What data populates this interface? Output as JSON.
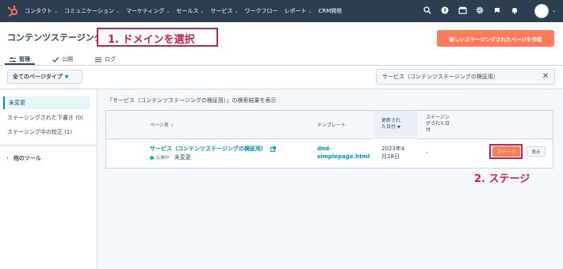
{
  "nav": {
    "items": [
      "コンタクト",
      "コミュニケーション",
      "マーケティング",
      "セールス",
      "サービス",
      "ワークフロー",
      "レポート",
      "CRM開発"
    ],
    "has_chevron": [
      true,
      true,
      true,
      true,
      true,
      false,
      true,
      false
    ],
    "icons": [
      "search-icon",
      "help-icon",
      "marketplace-icon",
      "settings-icon",
      "notifications-icon",
      "bell-icon"
    ]
  },
  "page": {
    "title": "コンテンツステージング",
    "annotation1": "1. ドメインを選択",
    "create_button": "新しいステージングされたページを作成"
  },
  "tabs": [
    {
      "label": "管理",
      "icon": "sliders-icon",
      "active": true
    },
    {
      "label": "公開",
      "icon": "check-icon",
      "active": false
    },
    {
      "label": "ログ",
      "icon": "list-icon",
      "active": false
    }
  ],
  "filter": {
    "page_type": "全てのページタイプ",
    "search_value": "サービス（コンテンツステージングの検証用）"
  },
  "sidebar": {
    "items": [
      "未変更",
      "ステージングされた下書き (0)",
      "ステージング中の校正 (1)"
    ],
    "other_tools": "他のツール"
  },
  "results": {
    "label": "「サービス（コンテンツステージングの検証用）」の検索結果を表示"
  },
  "table": {
    "headers": {
      "page_name": "ページ名",
      "template": "テンプレート",
      "updated_line1": "更新され",
      "updated_line2": "た日付",
      "staged_line1": "ステージン",
      "staged_line2": "グされた日",
      "staged_line3": "付"
    },
    "row": {
      "page_name": "サービス（コンテンツステージングの検証用）",
      "status_prefix": "公開中",
      "status": "未変更",
      "template_line1": "dnd-",
      "template_line2": "simplepage.html",
      "updated_line1": "2023年4",
      "updated_line2": "月28日",
      "staged": "-",
      "stage_button": "ステージ",
      "view_button": "表示"
    }
  },
  "annotation2": "2. ステージ",
  "colors": {
    "nav_bg": "#2d3e50",
    "accent": "#ff7a59",
    "annotation": "#c4234e",
    "link": "#0091ae"
  }
}
